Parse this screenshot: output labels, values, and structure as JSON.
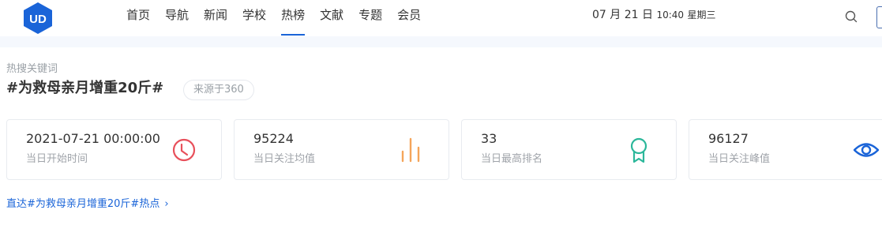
{
  "header": {
    "nav": [
      "首页",
      "导航",
      "新闻",
      "学校",
      "热榜",
      "文献",
      "专题",
      "会员"
    ],
    "active_nav": "热榜",
    "date": "07 月 21 日",
    "time": "10:40",
    "weekday": "星期三"
  },
  "keyword": {
    "section_label": "热搜关键词",
    "title": "#为救母亲月增重20斤#",
    "source": "来源于360"
  },
  "stats": [
    {
      "value": "2021-07-21 00:00:00",
      "label": "当日开始时间",
      "icon": "clock-icon",
      "color": "#e8505b"
    },
    {
      "value": "95224",
      "label": "当日关注均值",
      "icon": "bar-chart-icon",
      "color": "#f5a55a"
    },
    {
      "value": "33",
      "label": "当日最高排名",
      "icon": "award-icon",
      "color": "#2bb79a"
    },
    {
      "value": "96127",
      "label": "当日关注峰值",
      "icon": "eye-icon",
      "color": "#1a64d8"
    }
  ],
  "direct_link": "直达#为救母亲月增重20斤#热点",
  "colors": {
    "accent": "#1a64d8",
    "logo": "#1a64d8"
  }
}
